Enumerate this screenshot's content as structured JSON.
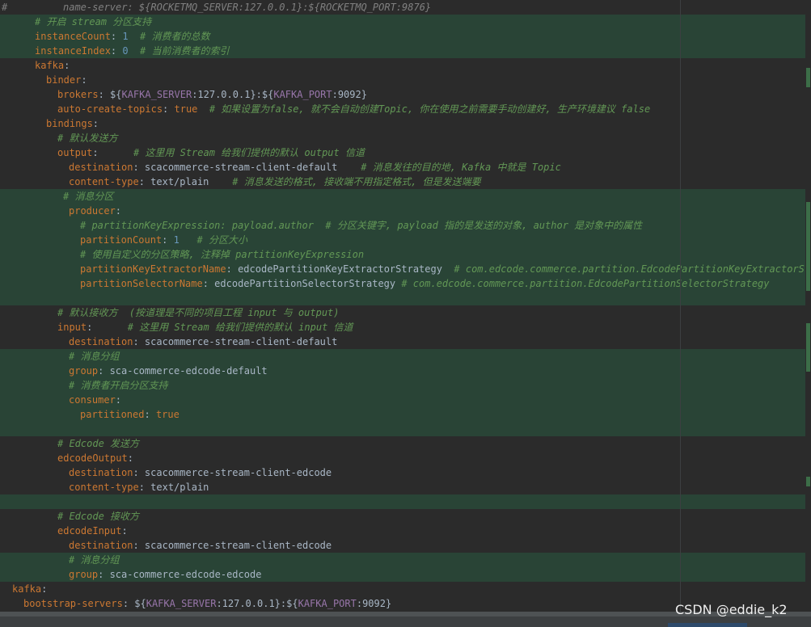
{
  "watermark": "CSDN @eddie_k2",
  "lines": [
    {
      "hl": false,
      "hash": true,
      "indent": 78,
      "segs": [
        {
          "t": "name-server: ${ROCKETMQ_SERVER:127.0.0.1}:${ROCKETMQ_PORT:9876}",
          "c": "c1"
        }
      ]
    },
    {
      "hl": true,
      "indent": 43,
      "segs": [
        {
          "t": "# 开启 stream 分区支持",
          "c": "c"
        }
      ]
    },
    {
      "hl": true,
      "indent": 43,
      "segs": [
        {
          "t": "instanceCount",
          "c": "k"
        },
        {
          "t": ": ",
          "c": "p"
        },
        {
          "t": "1",
          "c": "n"
        },
        {
          "t": "  # 消费者的总数",
          "c": "c"
        }
      ]
    },
    {
      "hl": true,
      "indent": 43,
      "segs": [
        {
          "t": "instanceIndex",
          "c": "k"
        },
        {
          "t": ": ",
          "c": "p"
        },
        {
          "t": "0",
          "c": "n"
        },
        {
          "t": "  # 当前消费者的索引",
          "c": "c"
        }
      ]
    },
    {
      "hl": false,
      "indent": 43,
      "segs": [
        {
          "t": "kafka",
          "c": "k"
        },
        {
          "t": ":",
          "c": "p"
        }
      ]
    },
    {
      "hl": false,
      "indent": 57,
      "segs": [
        {
          "t": "binder",
          "c": "k"
        },
        {
          "t": ":",
          "c": "p"
        }
      ]
    },
    {
      "hl": false,
      "indent": 71,
      "segs": [
        {
          "t": "brokers",
          "c": "k"
        },
        {
          "t": ": ${",
          "c": "p"
        },
        {
          "t": "KAFKA_SERVER",
          "c": "var"
        },
        {
          "t": ":127.0.0.1}:${",
          "c": "p"
        },
        {
          "t": "KAFKA_PORT",
          "c": "var"
        },
        {
          "t": ":9092}",
          "c": "p"
        }
      ]
    },
    {
      "hl": false,
      "indent": 71,
      "segs": [
        {
          "t": "auto-create-topics",
          "c": "k"
        },
        {
          "t": ": ",
          "c": "p"
        },
        {
          "t": "true",
          "c": "kw"
        },
        {
          "t": "  # 如果设置为false, 就不会自动创建Topic, 你在使用之前需要手动创建好, 生产环境建议 false",
          "c": "c"
        }
      ]
    },
    {
      "hl": false,
      "indent": 57,
      "segs": [
        {
          "t": "bindings",
          "c": "k"
        },
        {
          "t": ":",
          "c": "p"
        }
      ]
    },
    {
      "hl": false,
      "indent": 71,
      "segs": [
        {
          "t": "# 默认发送方",
          "c": "c"
        }
      ]
    },
    {
      "hl": false,
      "indent": 71,
      "segs": [
        {
          "t": "output",
          "c": "k"
        },
        {
          "t": ":      ",
          "c": "p"
        },
        {
          "t": "# 这里用 Stream 给我们提供的默认 output 信道",
          "c": "c"
        }
      ]
    },
    {
      "hl": false,
      "indent": 85,
      "segs": [
        {
          "t": "destination",
          "c": "k"
        },
        {
          "t": ": scacommerce-stream-client-default    ",
          "c": "p"
        },
        {
          "t": "# 消息发往的目的地, Kafka 中就是 Topic",
          "c": "c"
        }
      ]
    },
    {
      "hl": false,
      "indent": 85,
      "segs": [
        {
          "t": "content-type",
          "c": "k"
        },
        {
          "t": ": text/plain    ",
          "c": "p"
        },
        {
          "t": "# 消息发送的格式, 接收端不用指定格式, 但是发送端要",
          "c": "c"
        }
      ]
    },
    {
      "hl": true,
      "indent": 78,
      "segs": [
        {
          "t": "# 消息分区",
          "c": "c"
        }
      ]
    },
    {
      "hl": true,
      "indent": 85,
      "segs": [
        {
          "t": "producer",
          "c": "k"
        },
        {
          "t": ":",
          "c": "p"
        }
      ]
    },
    {
      "hl": true,
      "indent": 99,
      "segs": [
        {
          "t": "# partitionKeyExpression: payload.author  # 分区关键字, payload 指的是发送的对象, author 是对象中的属性",
          "c": "c"
        }
      ]
    },
    {
      "hl": true,
      "indent": 99,
      "segs": [
        {
          "t": "partitionCount",
          "c": "k"
        },
        {
          "t": ": ",
          "c": "p"
        },
        {
          "t": "1",
          "c": "n"
        },
        {
          "t": "   # 分区大小",
          "c": "c"
        }
      ]
    },
    {
      "hl": true,
      "indent": 99,
      "segs": [
        {
          "t": "# 使用自定义的分区策略, 注释掉 partitionKeyExpression",
          "c": "c"
        }
      ]
    },
    {
      "hl": true,
      "indent": 99,
      "segs": [
        {
          "t": "partitionKeyExtractorName",
          "c": "k"
        },
        {
          "t": ": edcodePartitionKeyExtractorStrategy  ",
          "c": "p"
        },
        {
          "t": "# com.edcode.commerce.partition.EdcodePartitionKeyExtractorStrategy",
          "c": "c"
        }
      ]
    },
    {
      "hl": true,
      "indent": 99,
      "segs": [
        {
          "t": "partitionSelectorName",
          "c": "k"
        },
        {
          "t": ": edcodePartitionSelectorStrategy ",
          "c": "p"
        },
        {
          "t": "# com.edcode.commerce.partition.EdcodePartitionSelectorStrategy",
          "c": "c"
        }
      ]
    },
    {
      "hl": true,
      "indent": 0,
      "segs": []
    },
    {
      "hl": false,
      "indent": 71,
      "segs": [
        {
          "t": "# 默认接收方  (按道理是不同的项目工程 input 与 output)",
          "c": "c"
        }
      ]
    },
    {
      "hl": false,
      "indent": 71,
      "segs": [
        {
          "t": "input",
          "c": "k"
        },
        {
          "t": ":      ",
          "c": "p"
        },
        {
          "t": "# 这里用 Stream 给我们提供的默认 input 信道",
          "c": "c"
        }
      ]
    },
    {
      "hl": false,
      "indent": 85,
      "segs": [
        {
          "t": "destination",
          "c": "k"
        },
        {
          "t": ": scacommerce-stream-client-default",
          "c": "p"
        }
      ]
    },
    {
      "hl": true,
      "indent": 85,
      "segs": [
        {
          "t": "# 消息分组",
          "c": "c"
        }
      ]
    },
    {
      "hl": true,
      "indent": 85,
      "segs": [
        {
          "t": "group",
          "c": "k"
        },
        {
          "t": ": sca-commerce-edcode-default",
          "c": "p"
        }
      ]
    },
    {
      "hl": true,
      "indent": 85,
      "segs": [
        {
          "t": "# 消费者开启分区支持",
          "c": "c"
        }
      ]
    },
    {
      "hl": true,
      "indent": 85,
      "segs": [
        {
          "t": "consumer",
          "c": "k"
        },
        {
          "t": ":",
          "c": "p"
        }
      ]
    },
    {
      "hl": true,
      "indent": 99,
      "segs": [
        {
          "t": "partitioned",
          "c": "k"
        },
        {
          "t": ": ",
          "c": "p"
        },
        {
          "t": "true",
          "c": "kw"
        }
      ]
    },
    {
      "hl": true,
      "indent": 0,
      "segs": []
    },
    {
      "hl": false,
      "indent": 71,
      "segs": [
        {
          "t": "# Edcode 发送方",
          "c": "c"
        }
      ]
    },
    {
      "hl": false,
      "indent": 71,
      "segs": [
        {
          "t": "edcodeOutput",
          "c": "k"
        },
        {
          "t": ":",
          "c": "p"
        }
      ]
    },
    {
      "hl": false,
      "indent": 85,
      "segs": [
        {
          "t": "destination",
          "c": "k"
        },
        {
          "t": ": scacommerce-stream-client-edcode",
          "c": "p"
        }
      ]
    },
    {
      "hl": false,
      "indent": 85,
      "segs": [
        {
          "t": "content-type",
          "c": "k"
        },
        {
          "t": ": text/plain",
          "c": "p"
        }
      ]
    },
    {
      "hl": true,
      "indent": 0,
      "segs": []
    },
    {
      "hl": false,
      "indent": 71,
      "segs": [
        {
          "t": "# Edcode 接收方",
          "c": "c"
        }
      ]
    },
    {
      "hl": false,
      "indent": 71,
      "segs": [
        {
          "t": "edcodeInput",
          "c": "k"
        },
        {
          "t": ":",
          "c": "p"
        }
      ]
    },
    {
      "hl": false,
      "indent": 85,
      "segs": [
        {
          "t": "destination",
          "c": "k"
        },
        {
          "t": ": scacommerce-stream-client-edcode",
          "c": "p"
        }
      ]
    },
    {
      "hl": true,
      "indent": 85,
      "segs": [
        {
          "t": "# 消息分组",
          "c": "c"
        }
      ]
    },
    {
      "hl": true,
      "indent": 85,
      "segs": [
        {
          "t": "group",
          "c": "k"
        },
        {
          "t": ": sca-commerce-edcode-edcode",
          "c": "p"
        }
      ]
    },
    {
      "hl": false,
      "indent": 15,
      "segs": [
        {
          "t": "kafka",
          "c": "k"
        },
        {
          "t": ":",
          "c": "p"
        }
      ]
    },
    {
      "hl": false,
      "indent": 29,
      "segs": [
        {
          "t": "bootstrap-servers",
          "c": "k"
        },
        {
          "t": ": ${",
          "c": "p"
        },
        {
          "t": "KAFKA_SERVER",
          "c": "var"
        },
        {
          "t": ":127.0.0.1}:${",
          "c": "p"
        },
        {
          "t": "KAFKA_PORT",
          "c": "var"
        },
        {
          "t": ":9092}",
          "c": "p"
        }
      ]
    }
  ]
}
